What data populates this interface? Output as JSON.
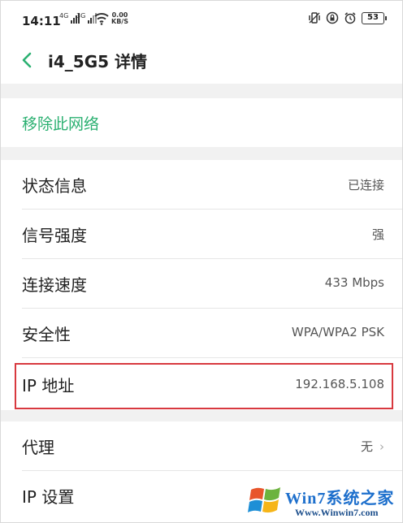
{
  "status_bar": {
    "time": "14:11",
    "signal1_label": "4G",
    "signal2_label": "3G",
    "speed_value": "0.00",
    "speed_unit": "KB/S",
    "battery": "53"
  },
  "header": {
    "title": "i4_5G5 详情"
  },
  "actions": {
    "remove_network": "移除此网络"
  },
  "details": [
    {
      "label": "状态信息",
      "value": "已连接"
    },
    {
      "label": "信号强度",
      "value": "强"
    },
    {
      "label": "连接速度",
      "value": "433 Mbps"
    },
    {
      "label": "安全性",
      "value": "WPA/WPA2 PSK"
    },
    {
      "label": "IP 地址",
      "value": "192.168.5.108"
    }
  ],
  "settings": [
    {
      "label": "代理",
      "value": "无"
    },
    {
      "label": "IP 设置",
      "value": ""
    }
  ],
  "watermark": {
    "brand": "Win7系统之家",
    "url": "Www.Winwin7.com"
  },
  "colors": {
    "accent": "#2bb071",
    "highlight_border": "#d8393f"
  }
}
